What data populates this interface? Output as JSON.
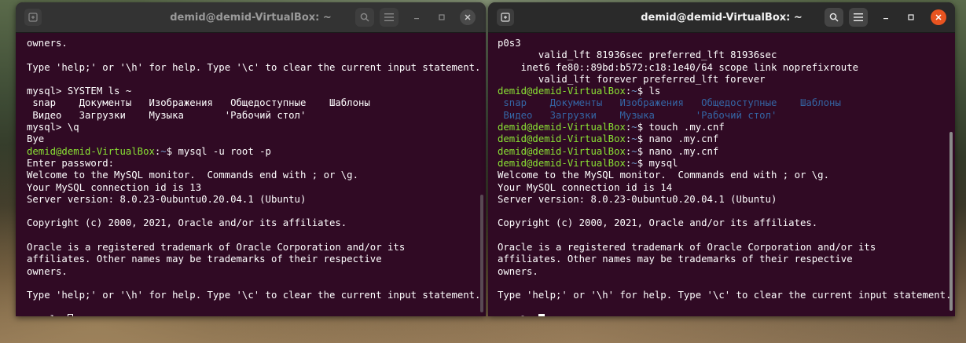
{
  "left_window": {
    "title": "demid@demid-VirtualBox: ~",
    "lines": [
      {
        "text": "owners."
      },
      {
        "text": ""
      },
      {
        "text": "Type 'help;' or '\\h' for help. Type '\\c' to clear the current input statement."
      },
      {
        "text": ""
      },
      {
        "text": "mysql> SYSTEM ls ~"
      },
      {
        "text": " snap    Документы   Изображения   Общедоступные    Шаблоны"
      },
      {
        "text": " Видео   Загрузки    Музыка       'Рабочий стол'"
      },
      {
        "text": "mysql> \\q"
      },
      {
        "text": "Bye"
      },
      {
        "prompt": true,
        "user": "demid@demid-VirtualBox",
        "path": "~",
        "cmd": "mysql -u root -p"
      },
      {
        "text": "Enter password:"
      },
      {
        "text": "Welcome to the MySQL monitor.  Commands end with ; or \\g."
      },
      {
        "text": "Your MySQL connection id is 13"
      },
      {
        "text": "Server version: 8.0.23-0ubuntu0.20.04.1 (Ubuntu)"
      },
      {
        "text": ""
      },
      {
        "text": "Copyright (c) 2000, 2021, Oracle and/or its affiliates."
      },
      {
        "text": ""
      },
      {
        "text": "Oracle is a registered trademark of Oracle Corporation and/or its"
      },
      {
        "text": "affiliates. Other names may be trademarks of their respective"
      },
      {
        "text": "owners."
      },
      {
        "text": ""
      },
      {
        "text": "Type 'help;' or '\\h' for help. Type '\\c' to clear the current input statement."
      },
      {
        "text": ""
      },
      {
        "text": "mysql> ",
        "cursor": "hollow"
      }
    ]
  },
  "right_window": {
    "title": "demid@demid-VirtualBox: ~",
    "lines": [
      {
        "text": "p0s3"
      },
      {
        "text": "       valid_lft 81936sec preferred_lft 81936sec"
      },
      {
        "text": "    inet6 fe80::89bd:b572:c18:1e40/64 scope link noprefixroute"
      },
      {
        "text": "       valid_lft forever preferred_lft forever"
      },
      {
        "prompt": true,
        "user": "demid@demid-VirtualBox",
        "path": "~",
        "cmd": "ls"
      },
      {
        "ls": true,
        "items": [
          " snap",
          "    Документы",
          "   Изображения",
          "   Общедоступные",
          "    Шаблоны"
        ]
      },
      {
        "ls": true,
        "items": [
          " Видео",
          "   Загрузки",
          "    Музыка",
          "       'Рабочий стол'"
        ]
      },
      {
        "prompt": true,
        "user": "demid@demid-VirtualBox",
        "path": "~",
        "cmd": "touch .my.cnf"
      },
      {
        "prompt": true,
        "user": "demid@demid-VirtualBox",
        "path": "~",
        "cmd": "nano .my.cnf"
      },
      {
        "prompt": true,
        "user": "demid@demid-VirtualBox",
        "path": "~",
        "cmd": "nano .my.cnf"
      },
      {
        "prompt": true,
        "user": "demid@demid-VirtualBox",
        "path": "~",
        "cmd": "mysql"
      },
      {
        "text": "Welcome to the MySQL monitor.  Commands end with ; or \\g."
      },
      {
        "text": "Your MySQL connection id is 14"
      },
      {
        "text": "Server version: 8.0.23-0ubuntu0.20.04.1 (Ubuntu)"
      },
      {
        "text": ""
      },
      {
        "text": "Copyright (c) 2000, 2021, Oracle and/or its affiliates."
      },
      {
        "text": ""
      },
      {
        "text": "Oracle is a registered trademark of Oracle Corporation and/or its"
      },
      {
        "text": "affiliates. Other names may be trademarks of their respective"
      },
      {
        "text": "owners."
      },
      {
        "text": ""
      },
      {
        "text": "Type 'help;' or '\\h' for help. Type '\\c' to clear the current input statement."
      },
      {
        "text": ""
      },
      {
        "text": "mysql> ",
        "cursor": "solid"
      }
    ]
  },
  "icons": {
    "new_tab": "new-tab-icon",
    "search": "search-icon",
    "menu": "hamburger-menu-icon",
    "minimize": "minimize-icon",
    "maximize": "maximize-icon",
    "close": "close-icon"
  },
  "colors": {
    "terminal_bg": "#300a24",
    "prompt_user": "#8ae234",
    "prompt_path": "#729fcf",
    "ls_dir": "#3465a4",
    "close_active": "#e95420"
  }
}
